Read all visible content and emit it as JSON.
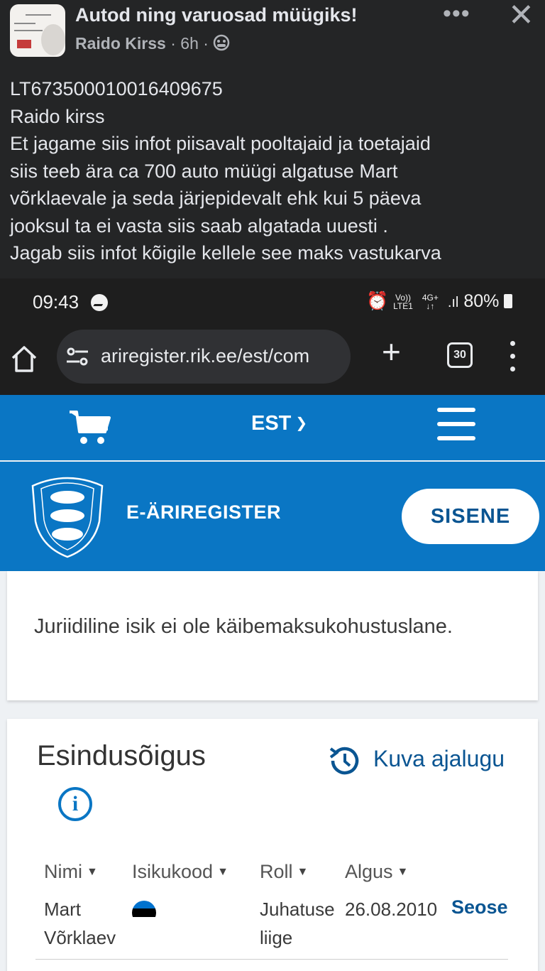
{
  "post": {
    "group_title": "Autod ning varuosad müügiks!",
    "author": "Raido Kirss",
    "time": "6h",
    "audience_icon": "group-icon",
    "more_icon": "ellipsis-icon",
    "close_icon": "close-icon",
    "lines": [
      "LT673500010016409675",
      "Raido kirss",
      "Et jagame siis infot piisavalt pooltajaid ja toetajaid",
      "siis teeb ära ca 700 auto müügi  algatuse Mart",
      "võrklaevale ja seda järjepidevalt ehk kui 5 päeva",
      "jooksul ta ei vasta siis saab algatada uuesti .",
      "Jagab siis infot kõigile kellele see maks vastukarva"
    ]
  },
  "phone": {
    "status_time": "09:43",
    "network_top": "Vo))",
    "network_bottom": "LTE1",
    "data_top": "4G+",
    "data_bottom": "↓↑",
    "battery": "80%",
    "url": "ariregister.rik.ee/est/com",
    "tab_count": "30"
  },
  "site": {
    "language": "EST",
    "brand": "E-ÄRIREGISTER",
    "login_label": "SISENE",
    "vat_note": "Juriidiline isik ei ole käibemaksukohustuslane.",
    "representation": {
      "title": "Esindusõigus",
      "history_label": "Kuva ajalugu",
      "columns": [
        "Nimi",
        "Isikukood",
        "Roll",
        "Algus"
      ],
      "rows": [
        {
          "name_line1": "Mart",
          "name_line2": "Võrklaev",
          "role_line1": "Juhatuse",
          "role_line2": "liige",
          "start": "26.08.2010",
          "link": "Seose"
        }
      ]
    }
  },
  "colors": {
    "fb_background": "#242526",
    "brand_blue": "#0a76c4",
    "link_blue": "#0a5592",
    "flag_blue": "#0072ce",
    "flag_black": "#000000",
    "flag_white": "#ffffff"
  }
}
